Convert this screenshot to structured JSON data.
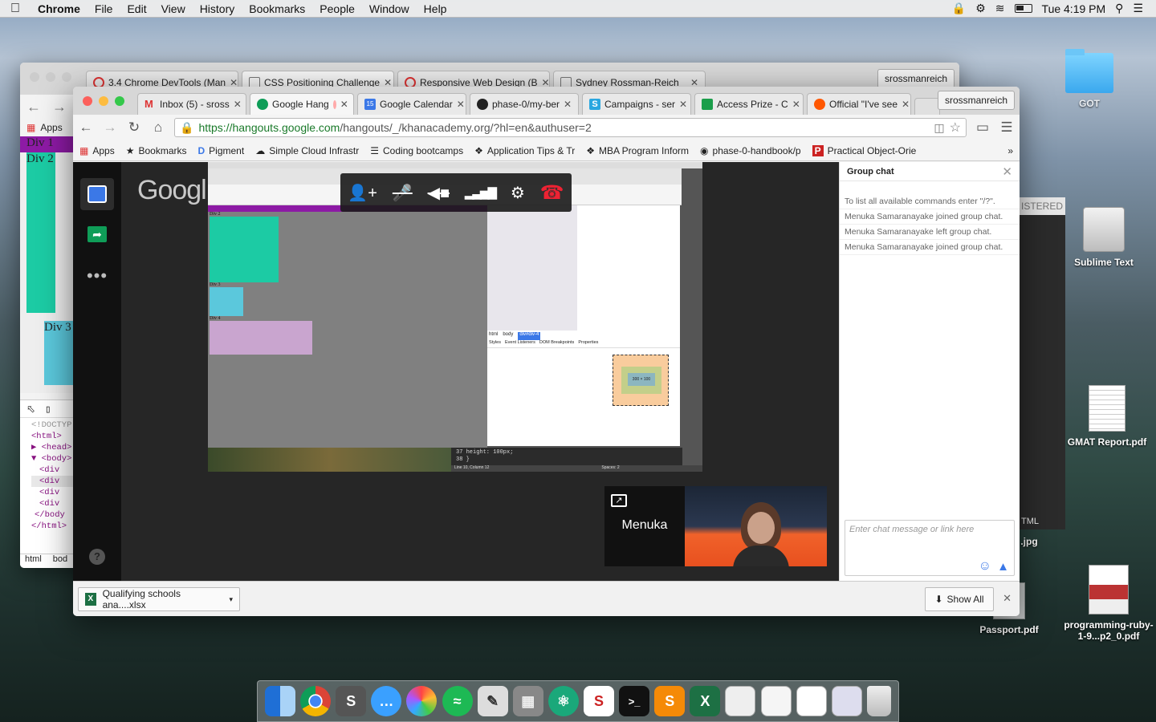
{
  "menubar": {
    "app": "Chrome",
    "items": [
      "File",
      "Edit",
      "View",
      "History",
      "Bookmarks",
      "People",
      "Window",
      "Help"
    ],
    "clock": "Tue 4:19 PM"
  },
  "desktop": {
    "icons": [
      {
        "label": "GOT",
        "kind": "folder"
      },
      {
        "label": "Sublime Text",
        "kind": "drive"
      },
      {
        "label": "GMAT Report.pdf",
        "kind": "doc"
      },
      {
        "label": ".jpg",
        "kind": "partial"
      },
      {
        "label": "Passport.pdf",
        "kind": "doc"
      },
      {
        "label": "programming-ruby-1-9...p2_0.pdf",
        "kind": "book"
      }
    ],
    "partial_listered": "ISTERED",
    "partial_tml": "TML"
  },
  "back_window": {
    "tabs": [
      "3.4 Chrome DevTools (Man",
      "CSS Positioning Challenge",
      "Responsive Web Design (B",
      "Sydney Rossman-Reich"
    ],
    "profile": "srossmanreich",
    "apps": "Apps",
    "divs": [
      "Div 1",
      "Div 2",
      "Div 3"
    ],
    "devtools_lines": [
      "<!DOCTYP",
      "<html>",
      "▶ <head>",
      "▼ <body>",
      "<div",
      "<div",
      "<div",
      "<div",
      "</body",
      "</html>"
    ],
    "crumbs": [
      "html",
      "bod"
    ]
  },
  "front_window": {
    "tabs": [
      "Inbox (5) - sross",
      "Google Hang",
      "Google Calendar",
      "phase-0/my-ber",
      "Campaigns - ser",
      "Access Prize - C",
      "Official \"I've see"
    ],
    "profile": "srossmanreich",
    "url_host": "https://hangouts.google.com",
    "url_path": "/hangouts/_/khanacademy.org/?hl=en&authuser=2",
    "bookmarks": [
      "Apps",
      "Bookmarks",
      "Pigment",
      "Simple Cloud Infrastr",
      "Coding bootcamps",
      "Application Tips & Tr",
      "MBA Program Inform",
      "phase-0-handbook/p",
      "Practical Object-Orie"
    ],
    "google_logo": "Googl",
    "participant": "Menuka",
    "chat": {
      "title": "Group chat",
      "messages": [
        "To list all available commands enter \"/?\".",
        "Menuka Samaranayake joined group chat.",
        "Menuka Samaranayake left group chat.",
        "Menuka Samaranayake joined group chat."
      ],
      "placeholder": "Enter chat message or link here"
    },
    "download": {
      "file": "Qualifying schools ana....xlsx",
      "show_all": "Show All"
    },
    "share": {
      "divs": [
        "Div 2",
        "Div 3",
        "Div 4"
      ],
      "code_lines": [
        "37    height: 100px;",
        "38  }"
      ],
      "status": "Line 10, Column 12",
      "spaces": "Spaces: 2",
      "crumbs": [
        "html",
        "body",
        "div#div-4"
      ],
      "tabs": [
        "Styles",
        "Event Listeners",
        "DOM Breakpoints",
        "Properties"
      ],
      "box": "300 × 100"
    }
  },
  "colors": {
    "teal": "#1ccba4",
    "lightblue": "#5bc8dc",
    "lavender": "#c9a5cf",
    "purple": "#8d1aa5",
    "hangout_green": "#0f9d58",
    "chat_accent": "#3b78e7"
  }
}
